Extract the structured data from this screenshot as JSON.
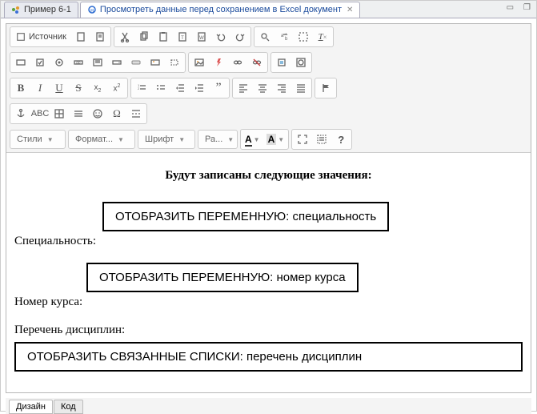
{
  "tabs": {
    "tab1": "Пример 6-1",
    "tab2": "Просмотреть данные перед сохранением в Excel документ"
  },
  "toolbar": {
    "source_label": "Источник",
    "styles": "Стили",
    "format": "Формат...",
    "font": "Шрифт",
    "size": "Ра...",
    "text_color": "A",
    "bg_color": "A"
  },
  "content": {
    "title": "Будут записаны следующие значения:",
    "label_specialty": "Специальность:",
    "var_specialty": "ОТОБРАЗИТЬ ПЕРЕМЕННУЮ: специальность",
    "label_course": "Номер курса:",
    "var_course": "ОТОБРАЗИТЬ ПЕРЕМЕННУЮ: номер курса",
    "label_disciplines": "Перечень дисциплин:",
    "var_disciplines": "ОТОБРАЗИТЬ СВЯЗАННЫЕ СПИСКИ: перечень дисциплин"
  },
  "bottom_tabs": {
    "design": "Дизайн",
    "code": "Код"
  }
}
